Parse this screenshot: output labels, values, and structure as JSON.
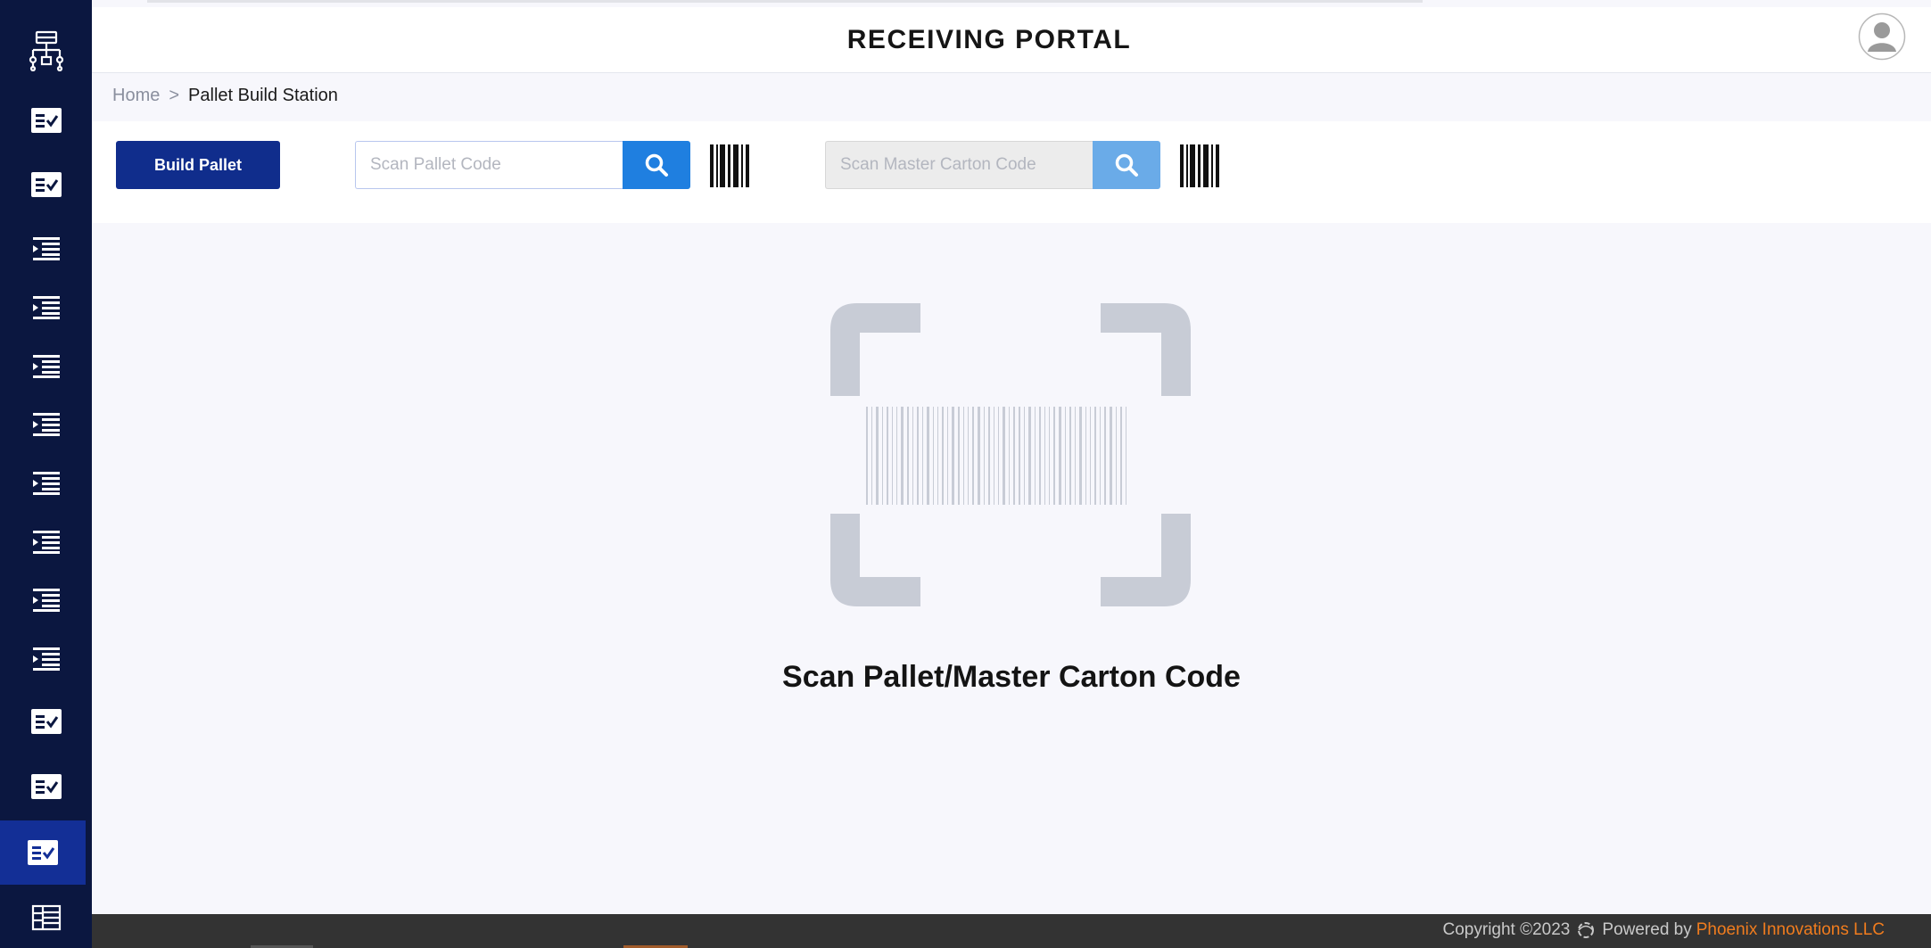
{
  "header": {
    "title": "RECEIVING PORTAL"
  },
  "breadcrumb": {
    "home": "Home",
    "separator": ">",
    "current": "Pallet Build Station"
  },
  "toolbar": {
    "build_pallet_label": "Build Pallet",
    "pallet_input": {
      "placeholder": "Scan Pallet Code",
      "value": ""
    },
    "carton_input": {
      "placeholder": "Scan Master Carton Code",
      "value": ""
    }
  },
  "main": {
    "prompt": "Scan Pallet/Master Carton Code"
  },
  "footer": {
    "copyright": "Copyright ©2023",
    "powered_by": "Powered by",
    "company": "Phoenix Innovations LLC"
  },
  "sidebar": {
    "items": [
      {
        "icon": "workflow-icon"
      },
      {
        "icon": "checklist-icon"
      },
      {
        "icon": "checklist-icon"
      },
      {
        "icon": "indent-list-icon"
      },
      {
        "icon": "indent-list-icon"
      },
      {
        "icon": "indent-list-icon"
      },
      {
        "icon": "indent-list-icon"
      },
      {
        "icon": "indent-list-icon"
      },
      {
        "icon": "indent-list-icon"
      },
      {
        "icon": "indent-list-icon"
      },
      {
        "icon": "indent-list-icon"
      },
      {
        "icon": "checklist-icon"
      },
      {
        "icon": "checklist-icon"
      },
      {
        "icon": "checklist-icon",
        "active": true
      },
      {
        "icon": "building-icon"
      }
    ]
  },
  "colors": {
    "sidebar_bg": "#0b1740",
    "sidebar_active": "#132f96",
    "primary_button": "#102d8c",
    "search_button": "#1f7fe0",
    "search_button_disabled": "#6aabe8",
    "footer_bg": "#333333",
    "footer_link": "#f07c1e",
    "illustration": "#c8ccd6"
  }
}
